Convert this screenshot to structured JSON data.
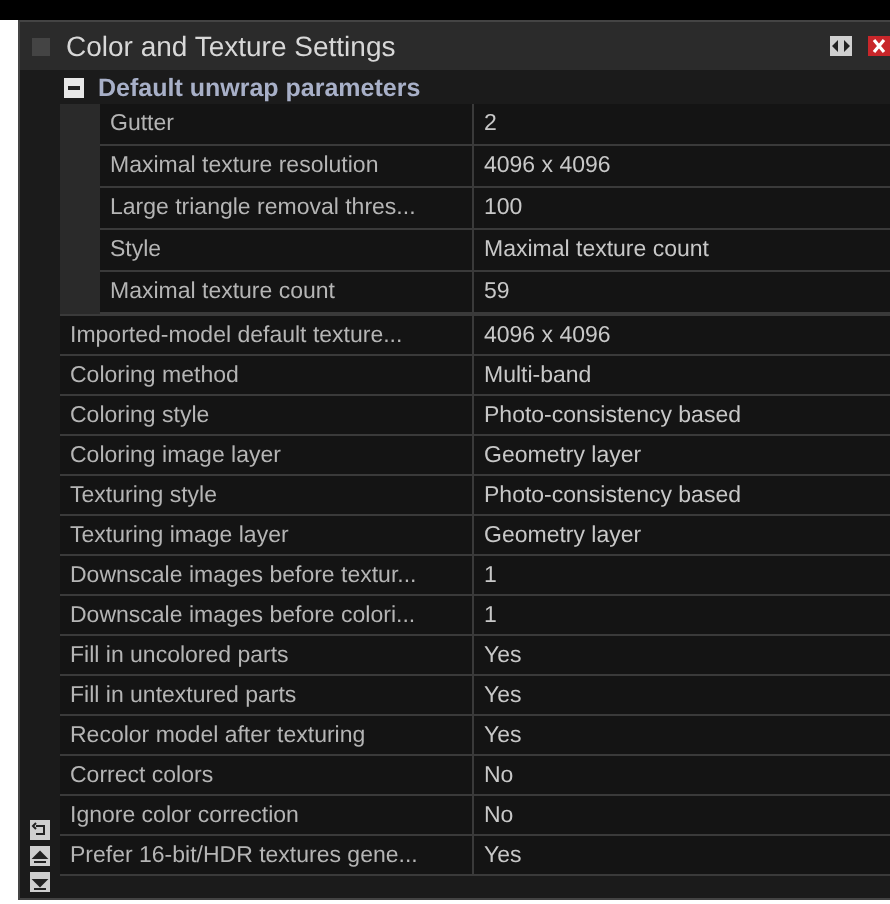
{
  "panel": {
    "title": "Color and Texture Settings"
  },
  "group": {
    "label": "Default unwrap parameters",
    "expanded": true,
    "rows": [
      {
        "name": "Gutter",
        "value": "2"
      },
      {
        "name": "Maximal texture resolution",
        "value": "4096 x 4096"
      },
      {
        "name": "Large triangle removal thres...",
        "value": "100"
      },
      {
        "name": "Style",
        "value": "Maximal texture count"
      },
      {
        "name": "Maximal texture count",
        "value": "59"
      }
    ]
  },
  "rows": [
    {
      "name": "Imported-model default texture...",
      "value": "4096 x 4096"
    },
    {
      "name": "Coloring method",
      "value": "Multi-band"
    },
    {
      "name": "Coloring style",
      "value": "Photo-consistency based"
    },
    {
      "name": "Coloring image layer",
      "value": "Geometry layer"
    },
    {
      "name": "Texturing style",
      "value": "Photo-consistency based"
    },
    {
      "name": "Texturing image layer",
      "value": "Geometry layer"
    },
    {
      "name": "Downscale images before textur...",
      "value": "1"
    },
    {
      "name": "Downscale images before colori...",
      "value": "1"
    },
    {
      "name": "Fill in uncolored parts",
      "value": "Yes"
    },
    {
      "name": "Fill in untextured parts",
      "value": "Yes"
    },
    {
      "name": "Recolor model after texturing",
      "value": "Yes"
    },
    {
      "name": "Correct colors",
      "value": "No"
    },
    {
      "name": "Ignore color correction",
      "value": "No"
    },
    {
      "name": "Prefer 16-bit/HDR textures gene...",
      "value": "Yes"
    }
  ]
}
